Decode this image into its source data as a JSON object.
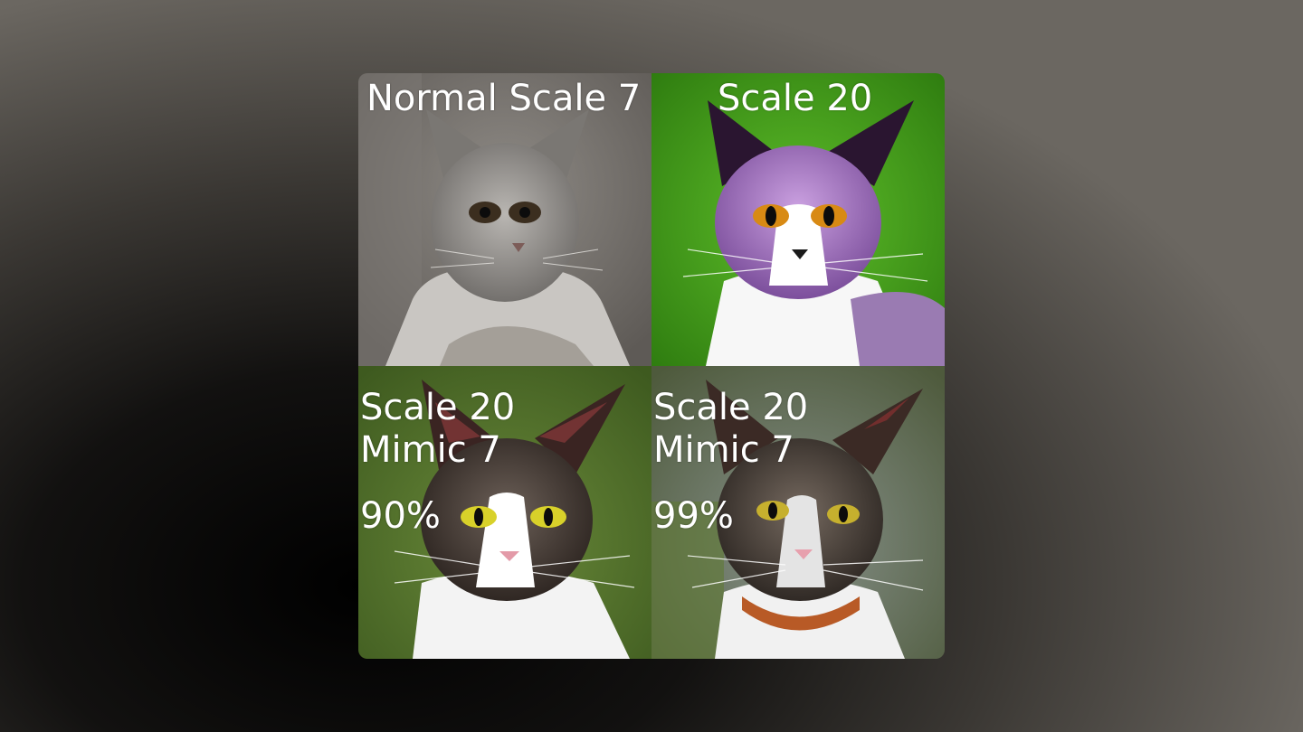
{
  "panels": [
    {
      "label": "Normal Scale 7"
    },
    {
      "label": "Scale 20"
    },
    {
      "label": "Scale 20",
      "sublabel": "Mimic 7",
      "percent": "90%"
    },
    {
      "label": "Scale 20",
      "sublabel": "Mimic 7",
      "percent": "99%"
    }
  ]
}
